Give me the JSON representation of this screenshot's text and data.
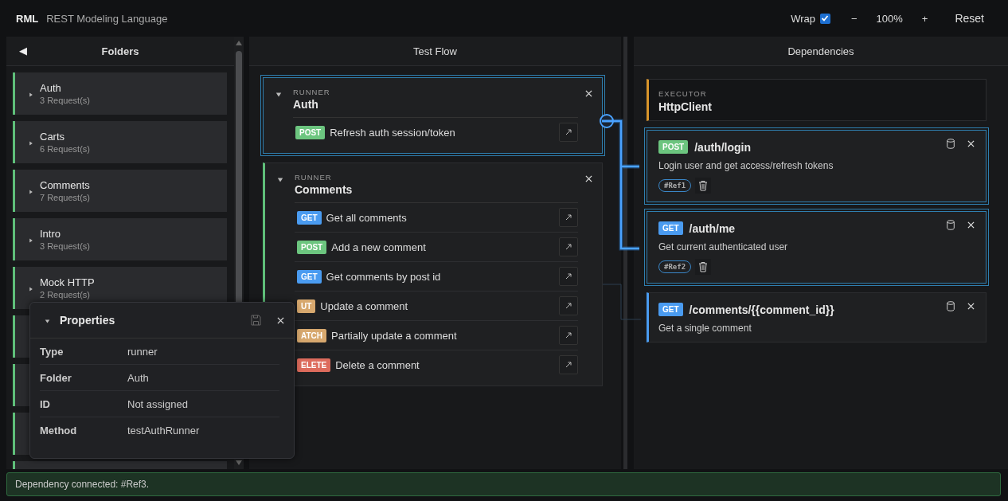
{
  "app": {
    "logo": "RML",
    "subtitle": "REST Modeling Language"
  },
  "toolbar": {
    "wrap_label": "Wrap",
    "wrap_checked": true,
    "zoom_out": "−",
    "zoom": "100%",
    "zoom_in": "+",
    "reset": "Reset"
  },
  "folders": {
    "collapse": "◀",
    "title": "Folders",
    "items": [
      {
        "kind": "folder",
        "name": "Auth",
        "count": "3 Request(s)",
        "expanded": false
      },
      {
        "kind": "folder",
        "name": "Carts",
        "count": "6 Request(s)",
        "expanded": false
      },
      {
        "kind": "folder",
        "name": "Comments",
        "count": "7 Request(s)",
        "expanded": false
      },
      {
        "kind": "folder",
        "name": "Intro",
        "count": "3 Request(s)",
        "expanded": false
      },
      {
        "kind": "folder",
        "name": "Mock HTTP",
        "count": "2 Request(s)",
        "expanded": false
      },
      {
        "kind": "obscured"
      },
      {
        "kind": "obscured"
      },
      {
        "kind": "obscured"
      },
      {
        "kind": "obscured"
      }
    ]
  },
  "test_flow": {
    "title": "Test Flow",
    "runners": [
      {
        "label": "RUNNER",
        "name": "Auth",
        "selected": true,
        "expanded": true,
        "requests": [
          {
            "method": "POST",
            "color": "#6cc57f",
            "title": "Refresh auth session/token"
          }
        ]
      },
      {
        "label": "RUNNER",
        "name": "Comments",
        "selected": false,
        "expanded": true,
        "requests": [
          {
            "method": "GET",
            "color": "#4a9bf0",
            "title": "Get all comments"
          },
          {
            "method": "POST",
            "color": "#6cc57f",
            "title": "Add a new comment"
          },
          {
            "method": "GET",
            "color": "#4a9bf0",
            "title": "Get comments by post id"
          },
          {
            "method": "UT",
            "color": "#d7a86e",
            "title": "Update a comment"
          },
          {
            "method": "ATCH",
            "color": "#d7a86e",
            "title": "Partially update a comment"
          },
          {
            "method": "ELETE",
            "color": "#dd6b5c",
            "title": "Delete a comment"
          }
        ]
      }
    ]
  },
  "dependencies": {
    "title": "Dependencies",
    "executor": {
      "label": "EXECUTOR",
      "name": "HttpClient"
    },
    "endpoints": [
      {
        "method": "POST",
        "color": "#6cc57f",
        "path": "/auth/login",
        "description": "Login user and get access/refresh tokens",
        "selected": true,
        "ref": "#Ref1"
      },
      {
        "method": "GET",
        "color": "#4a9bf0",
        "path": "/auth/me",
        "description": "Get current authenticated user",
        "selected": true,
        "ref": "#Ref2"
      },
      {
        "method": "GET",
        "color": "#4a9bf0",
        "path": "/comments/{{comment_id}}",
        "description": "Get a single comment",
        "selected": false
      }
    ]
  },
  "properties": {
    "title": "Properties",
    "expanded": true,
    "rows": [
      {
        "key": "Type",
        "value": "runner"
      },
      {
        "key": "Folder",
        "value": "Auth"
      },
      {
        "key": "ID",
        "value": "Not assigned"
      },
      {
        "key": "Method",
        "value": "testAuthRunner"
      }
    ]
  },
  "status": "Dependency connected: #Ref3."
}
